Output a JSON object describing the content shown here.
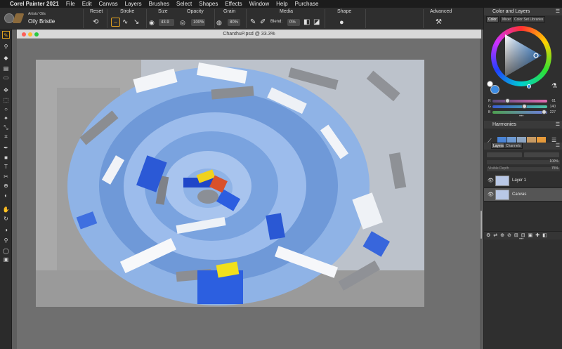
{
  "menubar": {
    "app": "Corel Painter 2021",
    "items": [
      "File",
      "Edit",
      "Canvas",
      "Layers",
      "Brushes",
      "Select",
      "Shapes",
      "Effects",
      "Window",
      "Help",
      "Purchase"
    ]
  },
  "propbar": {
    "brush_category": "Artists' Oils",
    "brush_variant": "Oily Bristle",
    "labels": {
      "reset": "Reset",
      "stroke": "Stroke",
      "size": "Size",
      "opacity": "Opacity",
      "grain": "Grain",
      "media": "Media",
      "shape": "Shape",
      "advanced": "Advanced"
    },
    "size_value": "43.9",
    "opacity_value": "100%",
    "grain_value": "80%",
    "blend_label": "Blend:",
    "blend_value": "0%"
  },
  "document": {
    "title": "ChanthuP.psd @ 33.3%",
    "window_controls": {
      "close": "#fd5f57",
      "minimize": "#febb2e",
      "zoom": "#29c940"
    }
  },
  "panels": {
    "color_panel_title": "Color and Layers",
    "color_tabs": [
      "Color",
      "Mixer",
      "Color Set Libraries"
    ],
    "rgb": [
      {
        "label": "R",
        "value": "61",
        "fraction": 0.24,
        "color": "#e06bb0"
      },
      {
        "label": "G",
        "value": "140",
        "fraction": 0.55,
        "color": "#4fc5a0"
      },
      {
        "label": "B",
        "value": "227",
        "fraction": 0.89,
        "color": "#6f7de0"
      }
    ],
    "current_color": "#3d8ce3",
    "harmonies_title": "Harmonies",
    "harmony_swatches": [
      "#4a84d6",
      "#6e9ad2",
      "#8da4c0",
      "#c79a63",
      "#e69a3a"
    ],
    "layers_tabs": [
      "Layers",
      "Channels"
    ],
    "opacity_value": "100%",
    "visible_depth_label": "Visible Depth",
    "visible_depth_value": "75%",
    "layers": [
      {
        "name": "Layer 1",
        "selected": false
      },
      {
        "name": "Canvas",
        "selected": true
      }
    ]
  },
  "colors": {
    "accent": "#e0a020",
    "canvas_grey": "#6f6f6f"
  }
}
